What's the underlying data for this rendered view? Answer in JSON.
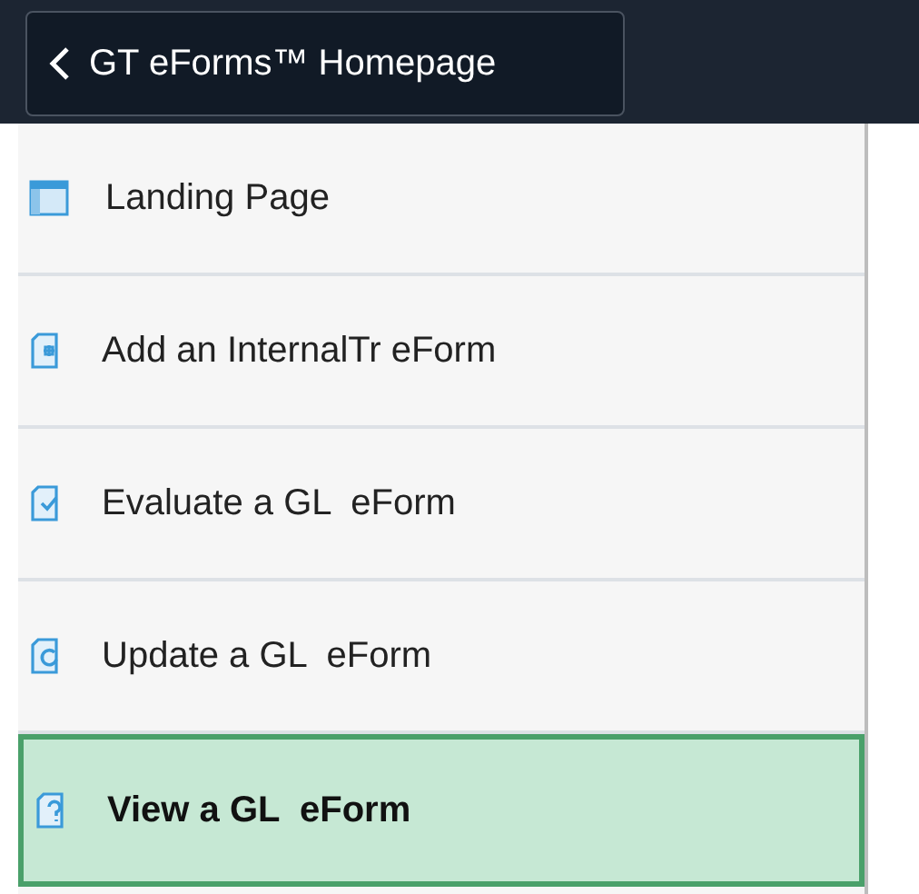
{
  "header": {
    "back_button": {
      "label": "GT eForms™ Homepage"
    }
  },
  "sidebar": {
    "items": [
      {
        "label": "Landing Page",
        "kind": "landing",
        "selected": false
      },
      {
        "label": "Add an InternalTr eForm",
        "kind": "add",
        "selected": false
      },
      {
        "label": "Evaluate a GL  eForm",
        "kind": "evaluate",
        "selected": false
      },
      {
        "label": "Update a GL  eForm",
        "kind": "update",
        "selected": false
      },
      {
        "label": "View a GL  eForm",
        "kind": "view",
        "selected": true
      }
    ]
  }
}
